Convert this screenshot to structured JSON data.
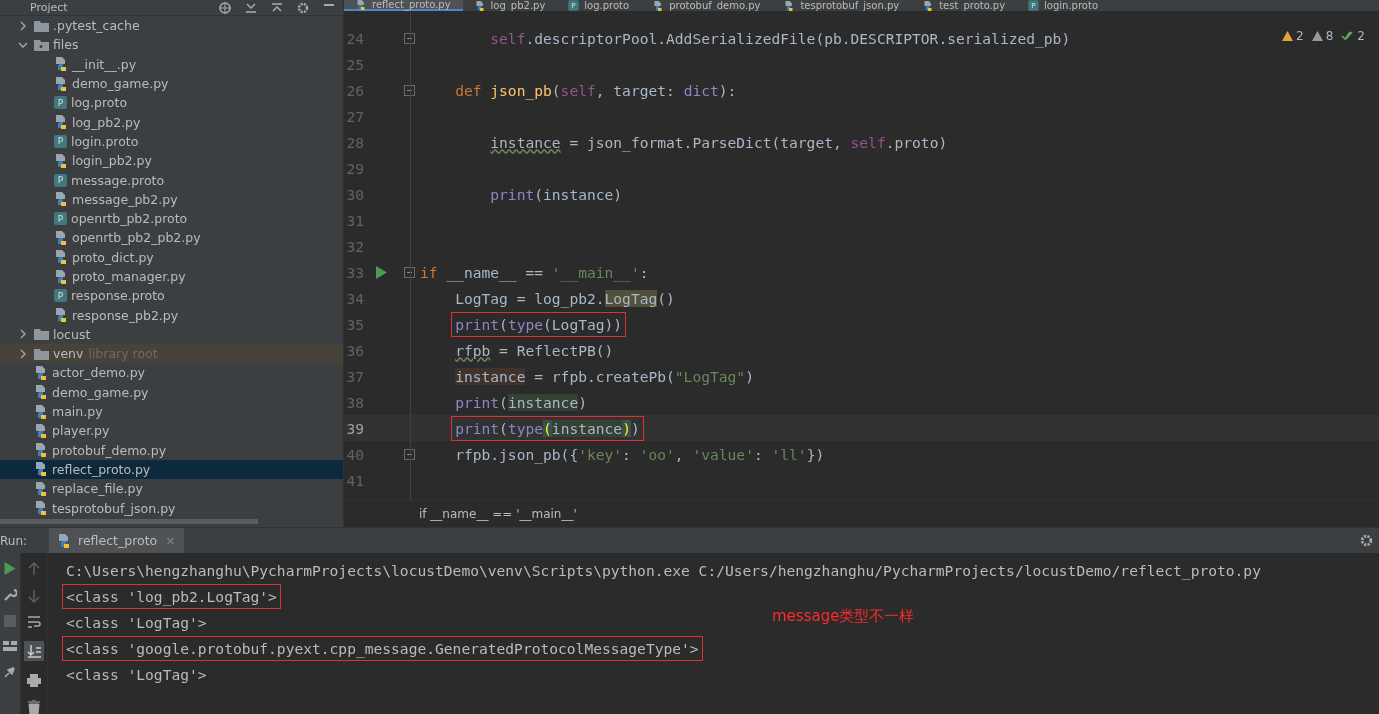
{
  "project_panel": {
    "title": "Project",
    "tree": [
      {
        "kind": "folder",
        "label": ".pytest_cache",
        "expanded": false,
        "selected": false
      },
      {
        "kind": "folder",
        "label": "files",
        "expanded": true,
        "selected": false,
        "children": [
          {
            "kind": "python",
            "label": "__init__.py",
            "selected": false
          },
          {
            "kind": "python",
            "label": "demo_game.py",
            "selected": false
          },
          {
            "kind": "proto",
            "icon_letter": "P",
            "label": "log.proto",
            "selected": false
          },
          {
            "kind": "python",
            "label": "log_pb2.py",
            "selected": false
          },
          {
            "kind": "proto",
            "icon_letter": "P",
            "label": "login.proto",
            "selected": false
          },
          {
            "kind": "python",
            "label": "login_pb2.py",
            "selected": false
          },
          {
            "kind": "proto",
            "icon_letter": "P",
            "label": "message.proto",
            "selected": false
          },
          {
            "kind": "python",
            "label": "message_pb2.py",
            "selected": false
          },
          {
            "kind": "proto",
            "icon_letter": "P",
            "label": "openrtb_pb2.proto",
            "selected": false
          },
          {
            "kind": "python",
            "label": "openrtb_pb2_pb2.py",
            "selected": false
          },
          {
            "kind": "python",
            "label": "proto_dict.py",
            "selected": false
          },
          {
            "kind": "python",
            "label": "proto_manager.py",
            "selected": false
          },
          {
            "kind": "proto",
            "icon_letter": "P",
            "label": "response.proto",
            "selected": false
          },
          {
            "kind": "python",
            "label": "response_pb2.py",
            "selected": false
          }
        ]
      },
      {
        "kind": "folder",
        "label": "locust",
        "expanded": false,
        "selected": false
      },
      {
        "kind": "folder",
        "label": "venv",
        "note": "library root",
        "expanded": false,
        "selected": false
      },
      {
        "kind": "python",
        "label": "actor_demo.py",
        "selected": false
      },
      {
        "kind": "python",
        "label": "demo_game.py",
        "selected": false
      },
      {
        "kind": "python",
        "label": "main.py",
        "selected": false
      },
      {
        "kind": "python",
        "label": "player.py",
        "selected": false
      },
      {
        "kind": "python",
        "label": "protobuf_demo.py",
        "selected": false
      },
      {
        "kind": "python",
        "label": "reflect_proto.py",
        "selected": true
      },
      {
        "kind": "python",
        "label": "replace_file.py",
        "selected": false
      },
      {
        "kind": "python",
        "label": "tesprotobuf_json.py",
        "selected": false
      }
    ]
  },
  "editor_tabs": [
    {
      "kind": "python",
      "label": "reflect_proto.py",
      "selected": true
    },
    {
      "kind": "python",
      "label": "log_pb2.py",
      "selected": false
    },
    {
      "kind": "proto",
      "icon_letter": "P",
      "label": "log.proto",
      "selected": false
    },
    {
      "kind": "python",
      "label": "protobuf_demo.py",
      "selected": false
    },
    {
      "kind": "python",
      "label": "tesprotobuf_json.py",
      "selected": false
    },
    {
      "kind": "python",
      "label": "test_proto.py",
      "selected": false
    },
    {
      "kind": "proto",
      "icon_letter": "P",
      "label": "login.proto",
      "selected": false
    }
  ],
  "inspections": [
    {
      "kind": "warning",
      "count": "2"
    },
    {
      "kind": "weak",
      "count": "8"
    },
    {
      "kind": "typo",
      "count": "2"
    }
  ],
  "code_lines": [
    {
      "number": "24",
      "fold": true,
      "tokens": [
        {
          "text": "        self",
          "kind": "self"
        },
        {
          "text": ".descriptorPool.AddSerializedFile(pb.DESCRIPTOR.serialized_pb)",
          "kind": "plain"
        }
      ]
    },
    {
      "number": "25"
    },
    {
      "number": "26",
      "fold": true,
      "tokens": [
        {
          "text": "    def",
          "kind": "kw"
        },
        {
          "text": " json_pb",
          "kind": "fn"
        },
        {
          "text": "(",
          "kind": "plain"
        },
        {
          "text": "self",
          "kind": "self"
        },
        {
          "text": ", target: ",
          "kind": "plain"
        },
        {
          "text": "dict",
          "kind": "builtin"
        },
        {
          "text": "):",
          "kind": "plain"
        }
      ]
    },
    {
      "number": "27"
    },
    {
      "number": "28",
      "tokens": [
        {
          "text": "        instance",
          "kind": "squiggle"
        },
        {
          "text": " = json_format.ParseDict(target, ",
          "kind": "plain"
        },
        {
          "text": "self",
          "kind": "self"
        },
        {
          "text": ".proto)",
          "kind": "plain"
        }
      ]
    },
    {
      "number": "29"
    },
    {
      "number": "30",
      "tokens": [
        {
          "text": "        print",
          "kind": "builtin"
        },
        {
          "text": "(instance)",
          "kind": "plain"
        }
      ]
    },
    {
      "number": "31"
    },
    {
      "number": "32"
    },
    {
      "number": "33",
      "run": true,
      "fold": true,
      "tokens": [
        {
          "text": "if",
          "kind": "kw"
        },
        {
          "text": " __name__ == ",
          "kind": "plain"
        },
        {
          "text": "'__main__'",
          "kind": "str"
        },
        {
          "text": ":",
          "kind": "plain"
        }
      ]
    },
    {
      "number": "34",
      "tokens": [
        {
          "text": "    LogTag = log_pb2.",
          "kind": "plain"
        },
        {
          "text": "LogTag",
          "kind": "usage"
        },
        {
          "text": "()",
          "kind": "plain"
        }
      ]
    },
    {
      "number": "35",
      "boxed": true,
      "tokens": [
        {
          "text": "    print",
          "kind": "builtin"
        },
        {
          "text": "(",
          "kind": "plain"
        },
        {
          "text": "type",
          "kind": "builtin"
        },
        {
          "text": "(LogTag))",
          "kind": "plain"
        }
      ]
    },
    {
      "number": "36",
      "tokens": [
        {
          "text": "    rfpb",
          "kind": "squiggle"
        },
        {
          "text": " = ReflectPB()",
          "kind": "plain"
        }
      ]
    },
    {
      "number": "37",
      "tokens": [
        {
          "text": "    instance",
          "kind": "write"
        },
        {
          "text": " = rfpb.createPb(",
          "kind": "plain"
        },
        {
          "text": "\"LogTag\"",
          "kind": "str"
        },
        {
          "text": ")",
          "kind": "plain"
        }
      ]
    },
    {
      "number": "38",
      "tokens": [
        {
          "text": "    print",
          "kind": "builtin"
        },
        {
          "text": "(",
          "kind": "plain"
        },
        {
          "text": "instance",
          "kind": "read"
        },
        {
          "text": ")",
          "kind": "plain"
        }
      ]
    },
    {
      "number": "39",
      "current": true,
      "boxed": true,
      "tokens": [
        {
          "text": "    print",
          "kind": "builtin"
        },
        {
          "text": "(",
          "kind": "plain"
        },
        {
          "text": "type",
          "kind": "builtin"
        },
        {
          "text": "(",
          "kind": "brace"
        },
        {
          "text": "instance",
          "kind": "read"
        },
        {
          "text": ")",
          "kind": "brace"
        },
        {
          "text": ")",
          "kind": "plain"
        }
      ]
    },
    {
      "number": "40",
      "fold": true,
      "tokens": [
        {
          "text": "    rfpb.json_pb({",
          "kind": "plain"
        },
        {
          "text": "'key'",
          "kind": "str"
        },
        {
          "text": ": ",
          "kind": "plain"
        },
        {
          "text": "'oo'",
          "kind": "str"
        },
        {
          "text": ", ",
          "kind": "plain"
        },
        {
          "text": "'value'",
          "kind": "str"
        },
        {
          "text": ": ",
          "kind": "plain"
        },
        {
          "text": "'ll'",
          "kind": "str"
        },
        {
          "text": "})",
          "kind": "plain"
        }
      ]
    },
    {
      "number": "41"
    }
  ],
  "breadcrumb": "if __name__ == '__main__'",
  "run_panel": {
    "label": "Run:",
    "tab": {
      "label": "reflect_proto",
      "close": "×"
    },
    "output": [
      {
        "text": "C:\\Users\\hengzhanghu\\PycharmProjects\\locustDemo\\venv\\Scripts\\python.exe C:/Users/hengzhanghu/PycharmProjects/locustDemo/reflect_proto.py",
        "boxed": false
      },
      {
        "text": "<class 'log_pb2.LogTag'>",
        "boxed": true
      },
      {
        "text": "<class 'LogTag'>",
        "boxed": false
      },
      {
        "text": "<class 'google.protobuf.pyext.cpp_message.GeneratedProtocolMessageType'>",
        "boxed": true
      },
      {
        "text": "<class 'LogTag'>",
        "boxed": false
      }
    ],
    "annotation": "message类型不一样"
  }
}
